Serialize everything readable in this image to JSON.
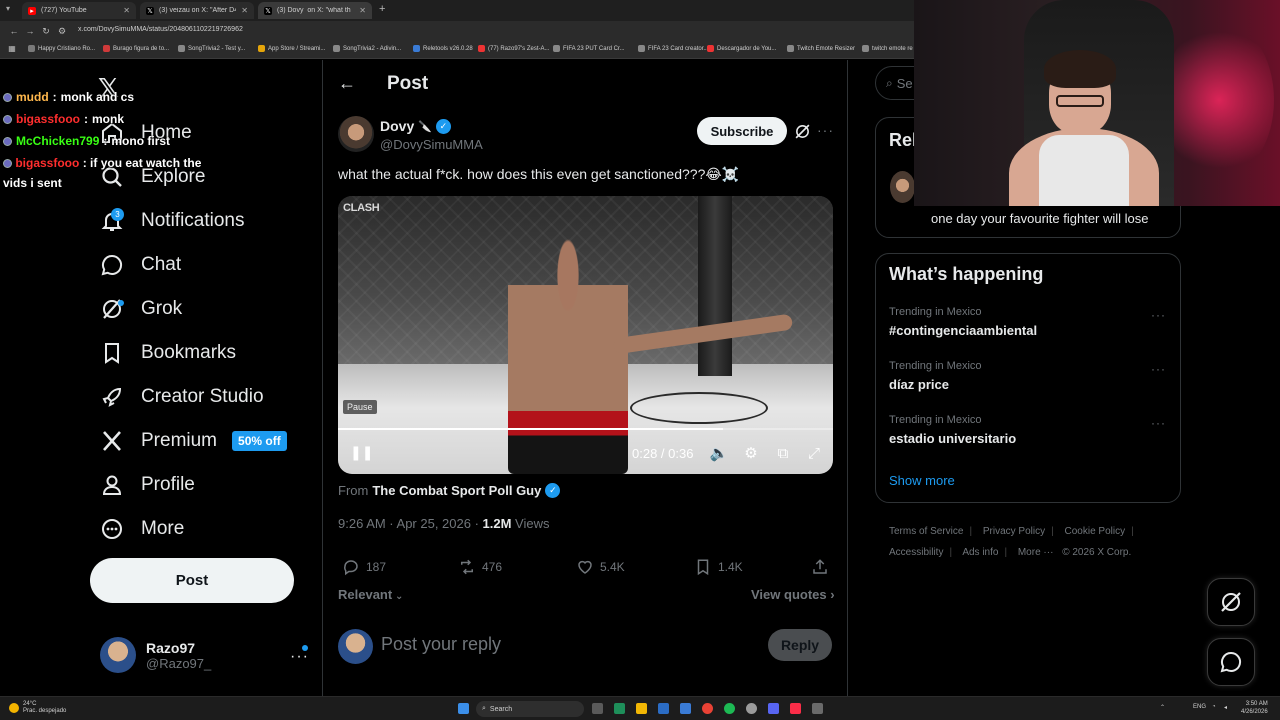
{
  "browser": {
    "tabs": [
      {
        "title": "(727) YouTube",
        "fav_color": "#ff0000",
        "active": false
      },
      {
        "title": "(3) veizau on X: \"After D4vd w",
        "fav_color": "#000000",
        "active": false
      },
      {
        "title": "(3) Dovy ​ on X: \"what th",
        "fav_color": "#000000",
        "active": true
      }
    ],
    "url": "x.com/DovySimuMMA/status/2048061102219726962",
    "bookmarks": [
      {
        "label": "Happy Cristiano Ro...",
        "color": "#7a7a7a"
      },
      {
        "label": "Burago figura de to...",
        "color": "#cf3a3a"
      },
      {
        "label": "SongTrivia2 - Test y...",
        "color": "#888"
      },
      {
        "label": "App Store / Streami...",
        "color": "#e5a50a"
      },
      {
        "label": "SongTrivia2 - Adivin...",
        "color": "#888"
      },
      {
        "label": "Reletools v26.0.28",
        "color": "#3a7bd5"
      },
      {
        "label": "(77) Razo97's Zest-A...",
        "color": "#e33"
      },
      {
        "label": "FIFA 23 PUT Card Cr...",
        "color": "#888"
      },
      {
        "label": "FIFA 23 Card creator...",
        "color": "#888"
      },
      {
        "label": "Descargador de You...",
        "color": "#e33"
      },
      {
        "label": "Twitch Emote Resizer",
        "color": "#888"
      },
      {
        "label": "twitch emote re",
        "color": "#888"
      }
    ]
  },
  "nav": {
    "items": [
      {
        "label": "Home"
      },
      {
        "label": "Explore"
      },
      {
        "label": "Notifications",
        "badge": "3"
      },
      {
        "label": "Chat"
      },
      {
        "label": "Grok"
      },
      {
        "label": "Bookmarks"
      },
      {
        "label": "Creator Studio"
      },
      {
        "label": "Premium",
        "pill": "50% off"
      },
      {
        "label": "Profile"
      },
      {
        "label": "More"
      }
    ],
    "post_button": "Post",
    "account": {
      "name": "Razo97",
      "handle": "@Razo97_",
      "more": "···"
    }
  },
  "chat_overlay": [
    {
      "user": "mudd",
      "color": "#ffb84d",
      "text": "monk and cs"
    },
    {
      "user": "bigassfooo",
      "color": "#ff2e2e",
      "text": "monk"
    },
    {
      "user": "McChicken799",
      "color": "#39ff14",
      "text": "mono first"
    },
    {
      "user": "bigassfooo",
      "color": "#ff2e2e",
      "text": "if you eat watch the vids i sent"
    }
  ],
  "post": {
    "heading": "Post",
    "author": {
      "name": "Dovy",
      "handle": "@DovySimuMMA"
    },
    "subscribe_label": "Subscribe",
    "text": "what the actual f*ck. how does this even get sanctioned???😂☠️",
    "video": {
      "watermark": "CLASH",
      "pause_tooltip": "Pause",
      "time": "0:28 / 0:36",
      "progress": 0.778
    },
    "from_prefix": "From",
    "from_source": "The Combat Sport Poll Guy",
    "timestamp": "9:26 AM · Apr 25, 2026 · ",
    "views_count": "1.2M",
    "views_label": " Views",
    "stats": {
      "replies": "187",
      "reposts": "476",
      "likes": "5.4K",
      "bookmarks": "1.4K"
    },
    "relevant_label": "Relevant",
    "view_quotes_label": "View quotes",
    "reply_placeholder": "Post your reply",
    "reply_button": "Reply"
  },
  "sidebar": {
    "search_placeholder": "Se",
    "relevant_title": "Rel",
    "relevant_bio": "one day your favourite fighter will lose",
    "happening_title": "What’s happening",
    "trends": [
      {
        "context": "Trending in Mexico",
        "name": "#contingenciaambiental"
      },
      {
        "context": "Trending in Mexico",
        "name": "díaz price"
      },
      {
        "context": "Trending in Mexico",
        "name": "estadio universitario"
      }
    ],
    "show_more": "Show more",
    "footer": [
      "Terms of Service",
      "Privacy Policy",
      "Cookie Policy",
      "Accessibility",
      "Ads info",
      "More ···",
      "© 2026 X Corp."
    ]
  },
  "taskbar": {
    "weather_temp": "24°C",
    "weather_desc": "Prac. despejado",
    "search": "Search",
    "lang": "ENG",
    "time": "3:50 AM",
    "date": "4/26/2026"
  },
  "colors": {
    "accent": "#1d9bf0",
    "background": "#000000",
    "border": "#2f3336",
    "muted": "#71767b"
  }
}
